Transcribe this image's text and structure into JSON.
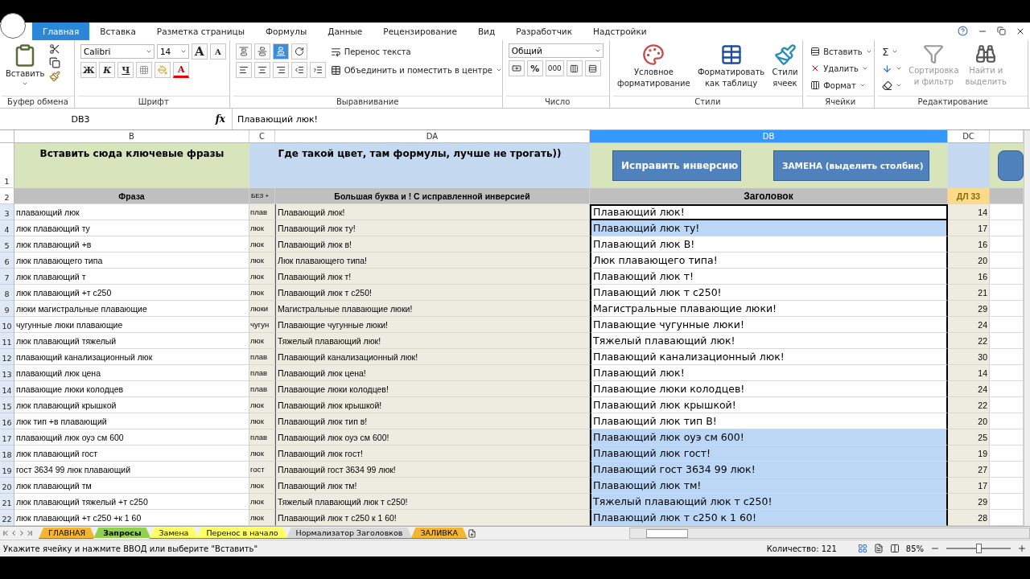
{
  "ribbon_tabs": [
    {
      "label": "Главная",
      "selected": true
    },
    {
      "label": "Вставка",
      "selected": false
    },
    {
      "label": "Разметка страницы",
      "selected": false
    },
    {
      "label": "Формулы",
      "selected": false
    },
    {
      "label": "Данные",
      "selected": false
    },
    {
      "label": "Рецензирование",
      "selected": false
    },
    {
      "label": "Вид",
      "selected": false
    },
    {
      "label": "Разработчик",
      "selected": false
    },
    {
      "label": "Надстройки",
      "selected": false
    }
  ],
  "ribbon": {
    "clipboard": {
      "label": "Буфер обмена",
      "paste": "Вставить"
    },
    "font": {
      "label": "Шрифт",
      "family": "Calibri",
      "size": "14",
      "grow": "A",
      "shrink": "A",
      "bold": "Ж",
      "italic": "К",
      "underline": "Ч",
      "font_color": "A"
    },
    "alignment": {
      "label": "Выравнивание",
      "vertical": [
        {
          "selected": false
        },
        {
          "selected": false
        },
        {
          "selected": true
        }
      ],
      "wrap": "Перенос текста",
      "merge": "Объединить и поместить в центре"
    },
    "number": {
      "label": "Число",
      "format": "Общий",
      "percent": "%",
      "thousands": "000"
    },
    "styles": {
      "label": "Стили",
      "buttons": [
        [
          "Условное",
          "форматирование"
        ],
        [
          "Форматировать",
          "как таблицу"
        ],
        [
          "Стили",
          "ячеек"
        ]
      ]
    },
    "cells": {
      "label": "Ячейки",
      "buttons": [
        "Вставить",
        "Удалить",
        "Формат"
      ]
    },
    "editing": {
      "label": "Редактирование",
      "sum": "Σ",
      "buttons": [
        [
          "Сортировка",
          "и фильтр"
        ],
        [
          "Найти и",
          "выделить"
        ]
      ]
    }
  },
  "formula_bar": {
    "name_box": "DB3",
    "function_label": "fx",
    "formula": "Плавающий люк!"
  },
  "columns": [
    {
      "label": "B",
      "selected": false
    },
    {
      "label": "C",
      "selected": false
    },
    {
      "label": "DA",
      "selected": false
    },
    {
      "label": "DB",
      "selected": true
    },
    {
      "label": "DC",
      "selected": false
    }
  ],
  "row_1": {
    "number": "1",
    "keywords_note": "Вставить сюда ключевые фразы",
    "formula_note": "Где такой цвет, там формулы, лучше не трогать))",
    "buttons": [
      "Исправить инверсию",
      "ЗАМЕНА (выделить столбик)"
    ]
  },
  "row_2": {
    "number": "2",
    "phrase": "Фраза",
    "column_c": "БЕЗ +",
    "corrected": "Большая буква и ! С исправленной инверсией",
    "title": "Заголовок",
    "length": "ДЛ 33"
  },
  "rows": [
    {
      "number": "3",
      "phrase": "плавающий люк",
      "column_c": "плав",
      "corrected": "Плавающий люк!",
      "title": "Плавающий люк!",
      "length": "14",
      "active": true,
      "selected": false
    },
    {
      "number": "4",
      "phrase": "люк плавающий ту",
      "column_c": "люк",
      "corrected": "Плавающий люк ту!",
      "title": "Плавающий люк ту!",
      "length": "17",
      "active": false,
      "selected": true
    },
    {
      "number": "5",
      "phrase": "люк плавающий +в",
      "column_c": "люк",
      "corrected": "Плавающий люк в!",
      "title": "Плавающий люк В!",
      "length": "16",
      "active": false,
      "selected": false
    },
    {
      "number": "6",
      "phrase": "люк плавающего типа",
      "column_c": "люк",
      "corrected": "Люк плавающего типа!",
      "title": "Люк плавающего типа!",
      "length": "20",
      "active": false,
      "selected": false
    },
    {
      "number": "7",
      "phrase": "люк плавающий т",
      "column_c": "люк",
      "corrected": "Плавающий люк т!",
      "title": "Плавающий люк т!",
      "length": "16",
      "active": false,
      "selected": false
    },
    {
      "number": "8",
      "phrase": "люк плавающий +т с250",
      "column_c": "люк",
      "corrected": "Плавающий люк т с250!",
      "title": "Плавающий люк т с250!",
      "length": "21",
      "active": false,
      "selected": false
    },
    {
      "number": "9",
      "phrase": "люки магистральные плавающие",
      "column_c": "люки",
      "corrected": "Магистральные плавающие люки!",
      "title": "Магистральные плавающие люки!",
      "length": "29",
      "active": false,
      "selected": false
    },
    {
      "number": "10",
      "phrase": "чугунные люки плавающие",
      "column_c": "чугун",
      "corrected": "Плавающие чугунные люки!",
      "title": "Плавающие чугунные люки!",
      "length": "24",
      "active": false,
      "selected": false
    },
    {
      "number": "11",
      "phrase": "люк плавающий тяжелый",
      "column_c": "люк",
      "corrected": "Тяжелый плавающий люк!",
      "title": "Тяжелый плавающий люк!",
      "length": "22",
      "active": false,
      "selected": false
    },
    {
      "number": "12",
      "phrase": "плавающий канализационный люк",
      "column_c": "плав",
      "corrected": "Плавающий канализационный люк!",
      "title": "Плавающий канализационный люк!",
      "length": "30",
      "active": false,
      "selected": false
    },
    {
      "number": "13",
      "phrase": "плавающий люк цена",
      "column_c": "плав",
      "corrected": "Плавающий люк цена!",
      "title": "Плавающий люк!",
      "length": "14",
      "active": false,
      "selected": false
    },
    {
      "number": "14",
      "phrase": "плавающие люки колодцев",
      "column_c": "плав",
      "corrected": "Плавающие люки колодцев!",
      "title": "Плавающие люки колодцев!",
      "length": "24",
      "active": false,
      "selected": false
    },
    {
      "number": "15",
      "phrase": "люк плавающий крышкой",
      "column_c": "люк",
      "corrected": "Плавающий люк крышкой!",
      "title": "Плавающий люк крышкой!",
      "length": "22",
      "active": false,
      "selected": false
    },
    {
      "number": "16",
      "phrase": "люк тип +в плавающий",
      "column_c": "люк",
      "corrected": "Плавающий люк тип в!",
      "title": "Плавающий люк тип В!",
      "length": "20",
      "active": false,
      "selected": false
    },
    {
      "number": "17",
      "phrase": "плавающий люк оуэ см 600",
      "column_c": "плав",
      "corrected": "Плавающий люк оуэ см 600!",
      "title": "Плавающий люк оуэ см 600!",
      "length": "25",
      "active": false,
      "selected": true
    },
    {
      "number": "18",
      "phrase": "люк плавающий гост",
      "column_c": "люк",
      "corrected": "Плавающий люк гост!",
      "title": "Плавающий люк гост!",
      "length": "19",
      "active": false,
      "selected": true
    },
    {
      "number": "19",
      "phrase": "гост 3634 99 люк плавающий",
      "column_c": "гост",
      "corrected": "Плавающий гост 3634 99 люк!",
      "title": "Плавающий гост 3634 99 люк!",
      "length": "27",
      "active": false,
      "selected": true
    },
    {
      "number": "20",
      "phrase": "люк плавающий тм",
      "column_c": "люк",
      "corrected": "Плавающий люк тм!",
      "title": "Плавающий люк тм!",
      "length": "17",
      "active": false,
      "selected": true
    },
    {
      "number": "21",
      "phrase": "люк плавающий тяжелый +т с250",
      "column_c": "люк",
      "corrected": "Тяжелый плавающий люк т с250!",
      "title": "Тяжелый плавающий люк т с250!",
      "length": "29",
      "active": false,
      "selected": true
    },
    {
      "number": "22",
      "phrase": "люк плавающий +т с250 +к 1 60",
      "column_c": "люк",
      "corrected": "Плавающий люк т с250 к 1 60!",
      "title": "Плавающий люк т с250 к 1 60!",
      "length": "28",
      "active": false,
      "selected": true
    }
  ],
  "sheet_tabs": [
    {
      "label": "ГЛАВНАЯ",
      "selected": false,
      "color": "#f2b632"
    },
    {
      "label": "Запросы",
      "selected": true,
      "color": "#92d050"
    },
    {
      "label": "Замена",
      "selected": false,
      "color": "#ffff66"
    },
    {
      "label": "Перенос в начало",
      "selected": false,
      "color": "#ffff66"
    },
    {
      "label": "Нормализатор Заголовков",
      "selected": false,
      "color": "#d9d9d9"
    },
    {
      "label": "ЗАЛИВКА",
      "selected": false,
      "color": "#f2b632"
    }
  ],
  "status_bar": {
    "message": "Укажите ячейку и нажмите ВВОД или выберите \"Вставить\"",
    "count": "Количество: 121",
    "zoom": "85%",
    "zoom_slider": {
      "level": 0.5
    }
  }
}
